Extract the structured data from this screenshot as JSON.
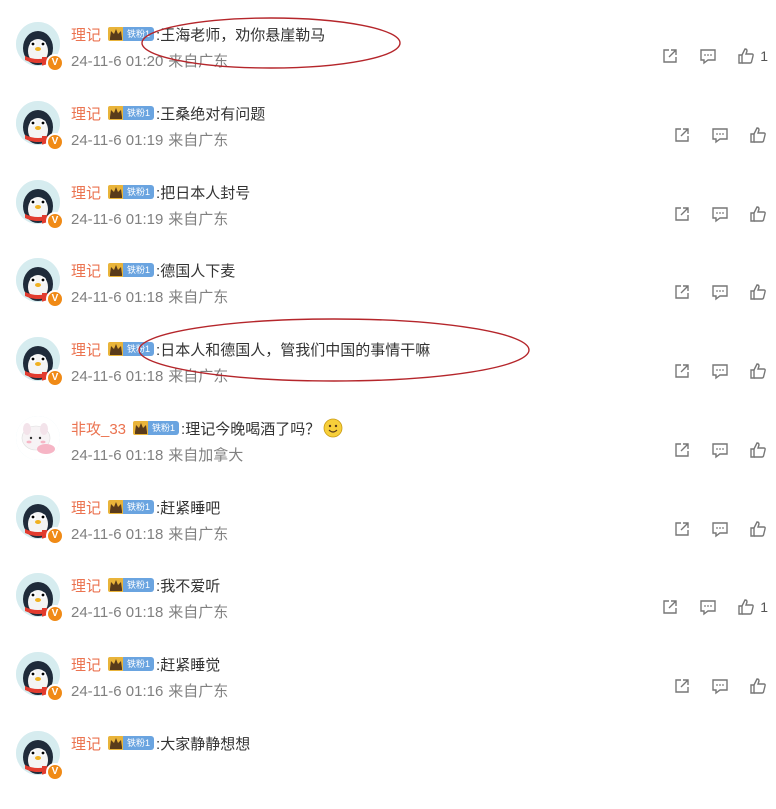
{
  "comments": [
    {
      "user": "理记",
      "fan": "铁粉1",
      "text": ":王海老师，劝你悬崖勒马",
      "time": "24-11-6 01:20",
      "loc": "来自广东",
      "likes": "1",
      "avatar": "penguin"
    },
    {
      "user": "理记",
      "fan": "铁粉1",
      "text": ":王桑绝对有问题",
      "time": "24-11-6 01:19",
      "loc": "来自广东",
      "likes": "",
      "avatar": "penguin"
    },
    {
      "user": "理记",
      "fan": "铁粉1",
      "text": ":把日本人封号",
      "time": "24-11-6 01:19",
      "loc": "来自广东",
      "likes": "",
      "avatar": "penguin"
    },
    {
      "user": "理记",
      "fan": "铁粉1",
      "text": ":德国人下麦",
      "time": "24-11-6 01:18",
      "loc": "来自广东",
      "likes": "",
      "avatar": "penguin"
    },
    {
      "user": "理记",
      "fan": "铁粉1",
      "text": ":日本人和德国人，管我们中国的事情干嘛",
      "time": "24-11-6 01:18",
      "loc": "来自广东",
      "likes": "",
      "avatar": "penguin"
    },
    {
      "user": "非攻_33",
      "fan": "铁粉1",
      "text": ":理记今晚喝酒了吗？",
      "time": "24-11-6 01:18",
      "loc": "来自加拿大",
      "likes": "",
      "avatar": "cartoon",
      "emoji": "smiley-emoji"
    },
    {
      "user": "理记",
      "fan": "铁粉1",
      "text": ":赶紧睡吧",
      "time": "24-11-6 01:18",
      "loc": "来自广东",
      "likes": "",
      "avatar": "penguin"
    },
    {
      "user": "理记",
      "fan": "铁粉1",
      "text": ":我不爱听",
      "time": "24-11-6 01:18",
      "loc": "来自广东",
      "likes": "1",
      "avatar": "penguin"
    },
    {
      "user": "理记",
      "fan": "铁粉1",
      "text": ":赶紧睡觉",
      "time": "24-11-6 01:16",
      "loc": "来自广东",
      "likes": "",
      "avatar": "penguin"
    },
    {
      "user": "理记",
      "fan": "铁粉1",
      "text": ":大家静静想想",
      "time": "",
      "loc": "",
      "likes": "",
      "avatar": "penguin"
    }
  ],
  "icons": {
    "share": "share-icon",
    "reply": "comment-icon",
    "like": "thumbs-up-icon",
    "verified": "v-badge-icon",
    "crown": "crown-icon"
  },
  "colors": {
    "username": "#eb7350",
    "fan_badge": "#6aa4e0",
    "annotation": "#b5262b",
    "meta": "#808080"
  }
}
